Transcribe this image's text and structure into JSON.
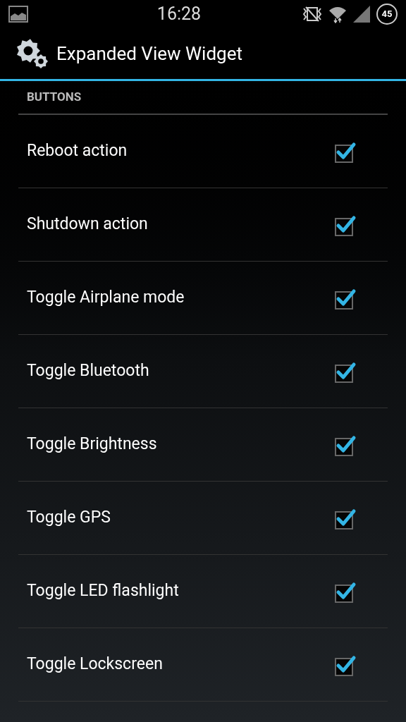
{
  "status_bar": {
    "time": "16:28",
    "battery": "45"
  },
  "action_bar": {
    "title": "Expanded View Widget"
  },
  "section": {
    "title": "BUTTONS"
  },
  "items": [
    {
      "label": "Reboot action",
      "checked": true
    },
    {
      "label": "Shutdown action",
      "checked": true
    },
    {
      "label": "Toggle Airplane mode",
      "checked": true
    },
    {
      "label": "Toggle Bluetooth",
      "checked": true
    },
    {
      "label": "Toggle Brightness",
      "checked": true
    },
    {
      "label": "Toggle GPS",
      "checked": true
    },
    {
      "label": "Toggle LED flashlight",
      "checked": true
    },
    {
      "label": "Toggle Lockscreen",
      "checked": true
    }
  ]
}
